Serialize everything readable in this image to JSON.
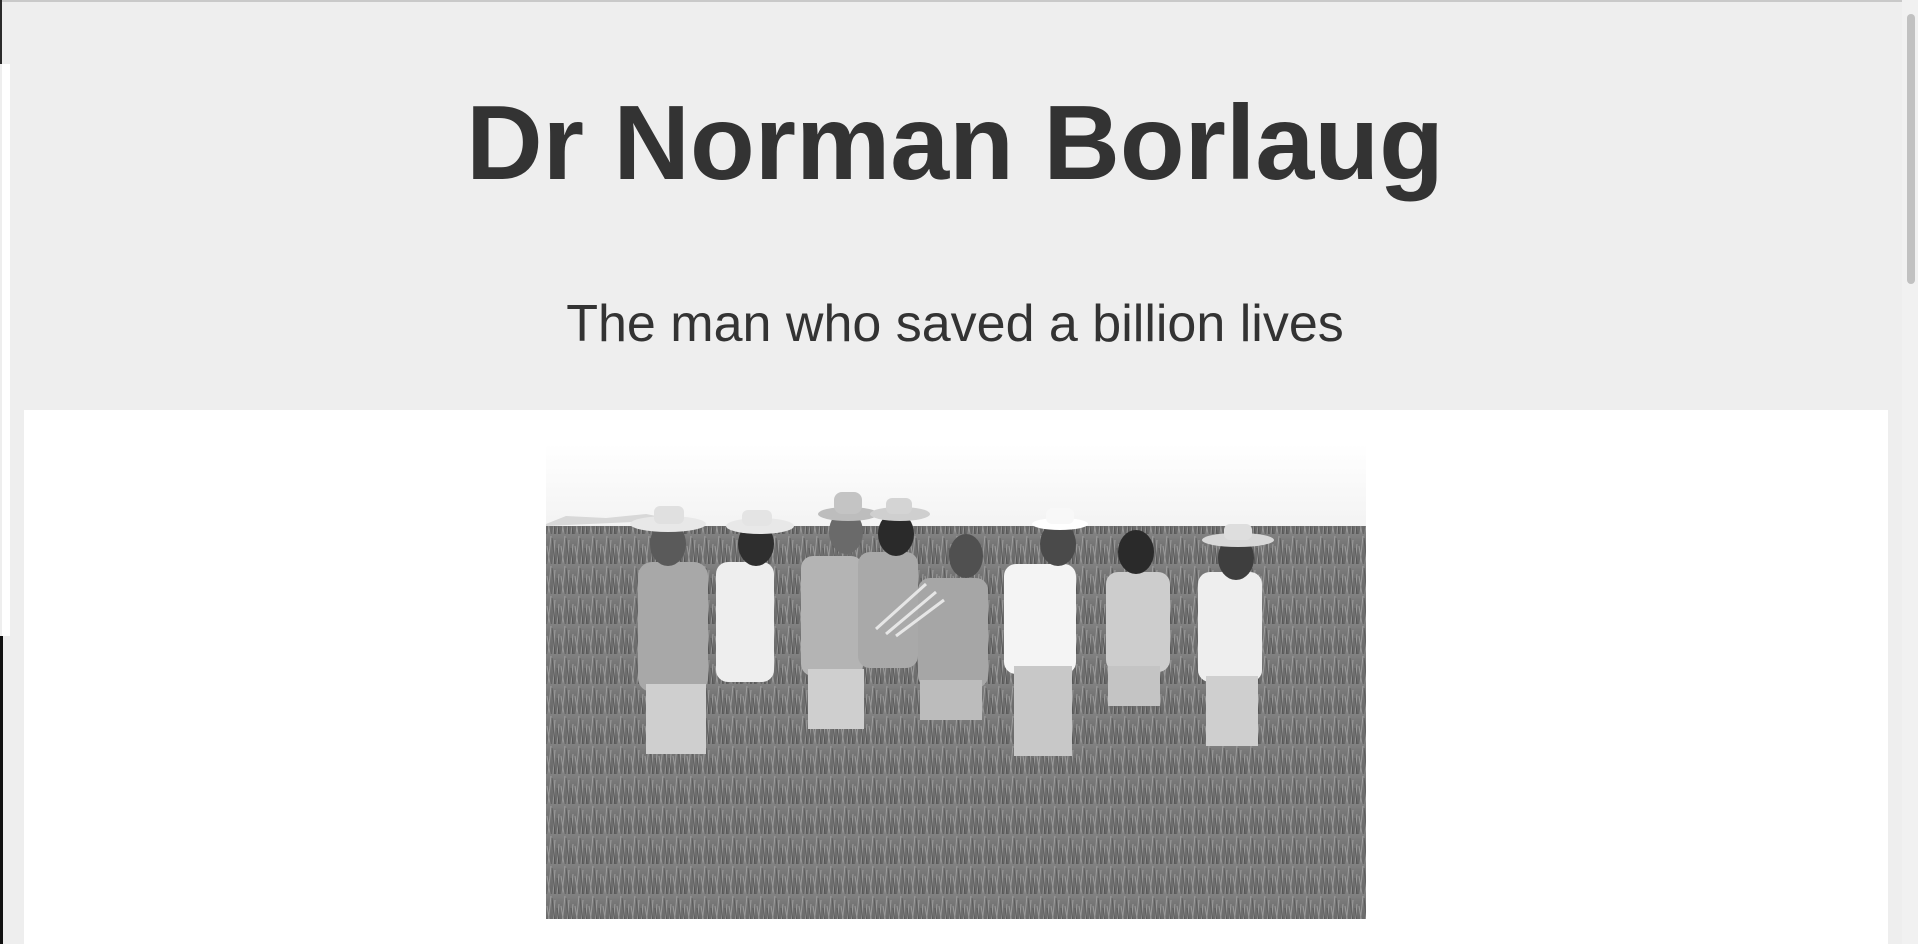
{
  "header": {
    "title": "Dr Norman Borlaug",
    "subtitle": "The man who saved a billion lives"
  },
  "photo": {
    "subject": "Group of nine men standing in a wheat field, examining wheat stalks",
    "style": "black-and-white photograph"
  },
  "colors": {
    "page_background": "#eeeeee",
    "text": "#333333",
    "card_background": "#ffffff"
  }
}
